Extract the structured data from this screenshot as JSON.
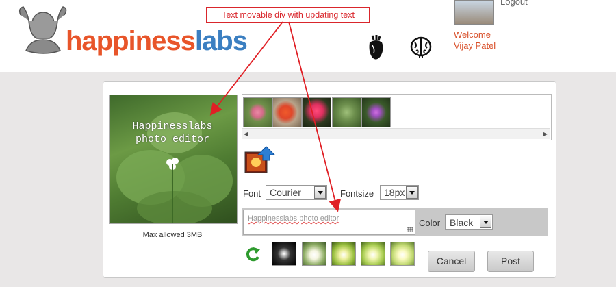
{
  "header": {
    "logo": {
      "part1": "happiness",
      "part2": "labs"
    },
    "annotation": "Text movable div with updating text",
    "user": {
      "logout": "Logout",
      "welcome": "Welcome",
      "name": "Vijay Patel"
    }
  },
  "editor": {
    "overlay_text": {
      "line1": "Happinesslabs",
      "line2": "photo editor"
    },
    "max_allowed": "Max allowed 3MB",
    "thumbnails": [
      "flower-1",
      "flower-2",
      "flower-3",
      "flower-4",
      "flower-5"
    ],
    "font_label": "Font",
    "font_value": "Courier",
    "fontsize_label": "Fontsize",
    "fontsize_value": "18px",
    "text_value": "Happinesslabs photo editor",
    "color_label": "Color",
    "color_value": "Black",
    "filters": [
      "filter-1",
      "filter-2",
      "filter-3",
      "filter-4",
      "filter-5"
    ],
    "cancel_label": "Cancel",
    "post_label": "Post"
  },
  "colors": {
    "brand_orange": "#e8552a",
    "brand_blue": "#3b7fc1",
    "annotation_red": "#d9262c"
  }
}
